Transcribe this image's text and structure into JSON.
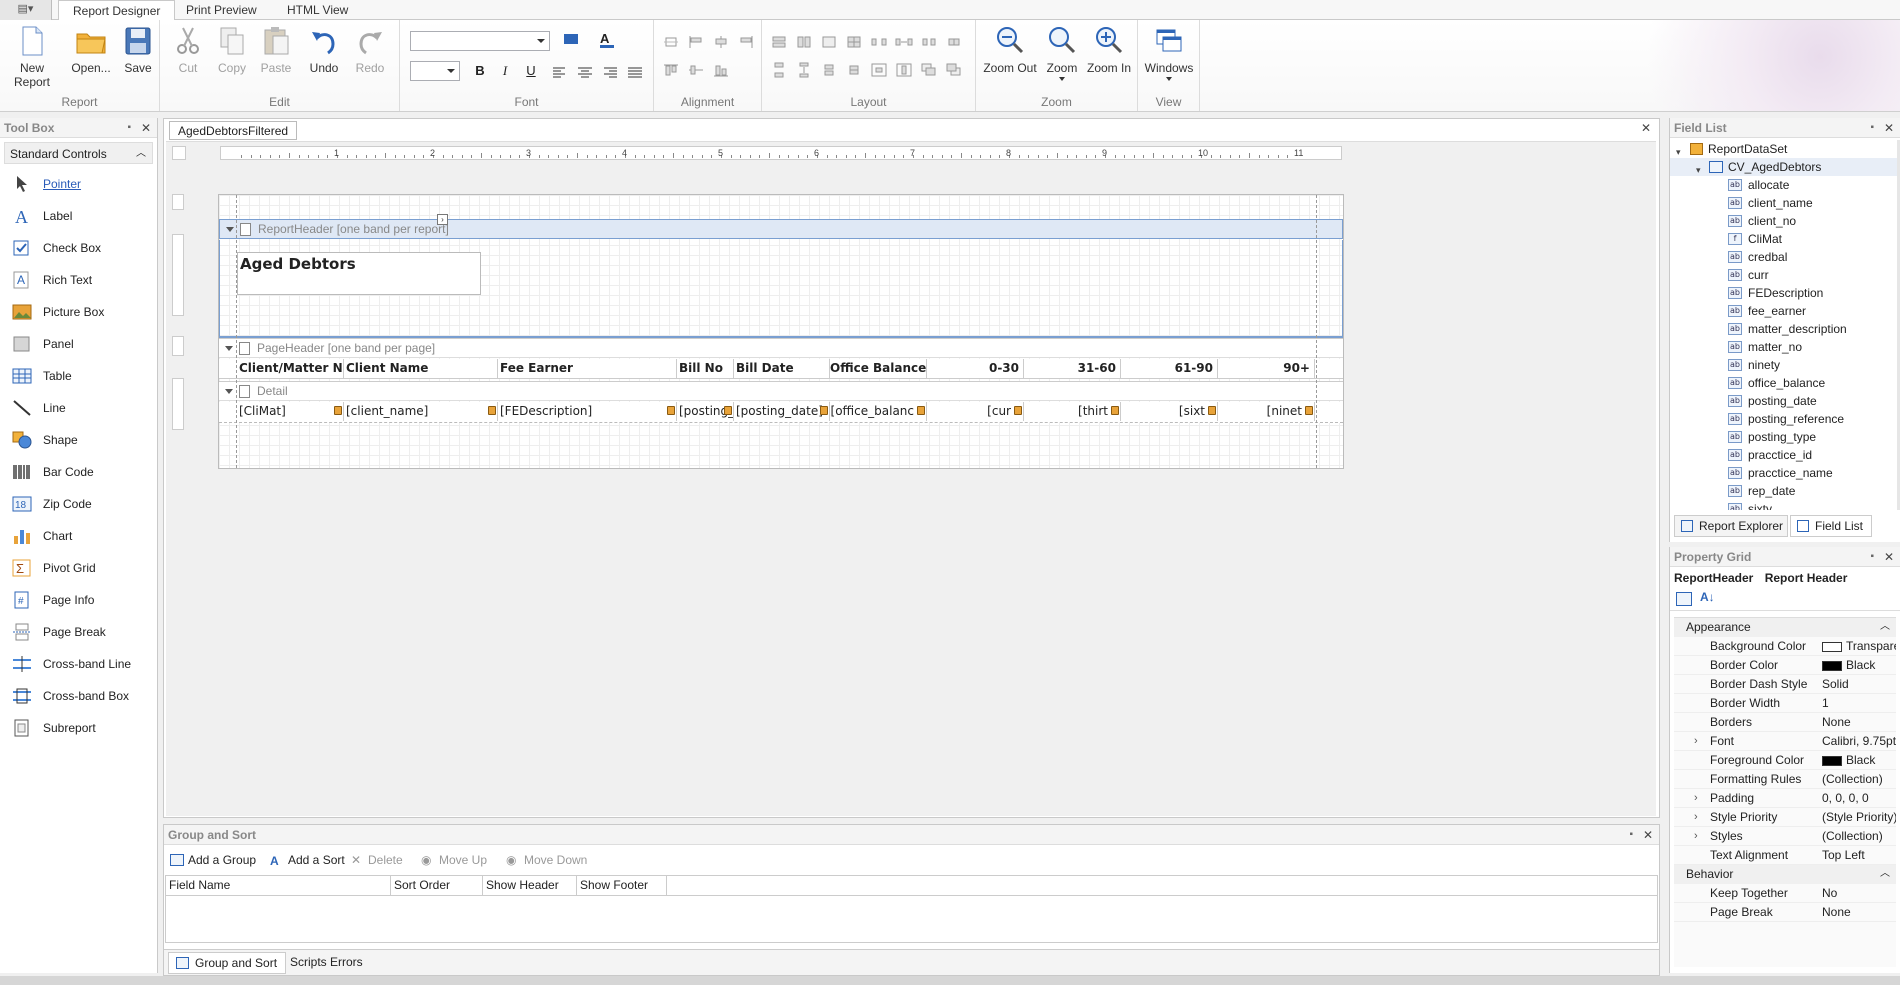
{
  "app": {
    "menu_button": "▤▾"
  },
  "tabs": [
    "Report Designer",
    "Print Preview",
    "HTML View"
  ],
  "ribbon": {
    "groups": {
      "report": "Report",
      "edit": "Edit",
      "font": "Font",
      "alignment": "Alignment",
      "layout": "Layout",
      "zoom": "Zoom",
      "view": "View"
    },
    "buttons": {
      "new_report": "New Report",
      "open": "Open...",
      "save": "Save",
      "cut": "Cut",
      "copy": "Copy",
      "paste": "Paste",
      "undo": "Undo",
      "redo": "Redo",
      "zoom_out": "Zoom Out",
      "zoom": "Zoom",
      "zoom_in": "Zoom In",
      "windows": "Windows"
    },
    "font_format": {
      "bold": "B",
      "italic": "I",
      "underline": "U"
    }
  },
  "toolbox": {
    "title": "Tool Box",
    "section": "Standard Controls",
    "items": [
      "Pointer",
      "Label",
      "Check Box",
      "Rich Text",
      "Picture Box",
      "Panel",
      "Table",
      "Line",
      "Shape",
      "Bar Code",
      "Zip Code",
      "Chart",
      "Pivot Grid",
      "Page Info",
      "Page Break",
      "Cross-band Line",
      "Cross-band Box",
      "Subreport"
    ]
  },
  "document": {
    "tab": "AgedDebtorsFiltered",
    "ruler_numbers": [
      "1",
      "2",
      "3",
      "4",
      "5",
      "6",
      "7",
      "8",
      "9",
      "10",
      "11"
    ],
    "bands": {
      "report_header": "ReportHeader [one band per report]",
      "page_header": "PageHeader [one band per page]",
      "detail": "Detail"
    },
    "report_title": "Aged Debtors",
    "header_cells": [
      "Client/Matter No",
      "Client Name",
      "Fee Earner",
      "Bill No",
      "Bill Date",
      "Office Balance",
      "0-30",
      "31-60",
      "61-90",
      "90+"
    ],
    "detail_cells": [
      "[CliMat]",
      "[client_name]",
      "[FEDescription]",
      "[posting_",
      "[posting_date]",
      "[office_balanc",
      "[cur",
      "[thirt",
      "[sixt",
      "[ninet"
    ]
  },
  "field_list": {
    "title": "Field List",
    "root": "ReportDataSet",
    "table": "CV_AgedDebtors",
    "fields": [
      {
        "name": "allocate",
        "icon": "ab"
      },
      {
        "name": "client_name",
        "icon": "ab"
      },
      {
        "name": "client_no",
        "icon": "ab"
      },
      {
        "name": "CliMat",
        "icon": "f"
      },
      {
        "name": "credbal",
        "icon": "ab"
      },
      {
        "name": "curr",
        "icon": "ab"
      },
      {
        "name": "FEDescription",
        "icon": "ab"
      },
      {
        "name": "fee_earner",
        "icon": "ab"
      },
      {
        "name": "matter_description",
        "icon": "ab"
      },
      {
        "name": "matter_no",
        "icon": "ab"
      },
      {
        "name": "ninety",
        "icon": "ab"
      },
      {
        "name": "office_balance",
        "icon": "ab"
      },
      {
        "name": "posting_date",
        "icon": "ab"
      },
      {
        "name": "posting_reference",
        "icon": "ab"
      },
      {
        "name": "posting_type",
        "icon": "ab"
      },
      {
        "name": "pracctice_id",
        "icon": "ab"
      },
      {
        "name": "pracctice_name",
        "icon": "ab"
      },
      {
        "name": "rep_date",
        "icon": "ab"
      },
      {
        "name": "sixty",
        "icon": "ab"
      }
    ],
    "tabs": [
      "Report Explorer",
      "Field List"
    ]
  },
  "property_grid": {
    "title": "Property Grid",
    "object_name": "ReportHeader",
    "object_type": "Report Header",
    "categories": [
      {
        "name": "Appearance",
        "rows": [
          {
            "name": "Background Color",
            "value": "Transparent",
            "swatch": "#ffffff"
          },
          {
            "name": "Border Color",
            "value": "Black",
            "swatch": "#000000"
          },
          {
            "name": "Border Dash Style",
            "value": "Solid"
          },
          {
            "name": "Border Width",
            "value": "1"
          },
          {
            "name": "Borders",
            "value": "None"
          },
          {
            "name": "Font",
            "value": "Calibri, 9.75pt",
            "expandable": true
          },
          {
            "name": "Foreground Color",
            "value": "Black",
            "swatch": "#000000"
          },
          {
            "name": "Formatting Rules",
            "value": "(Collection)"
          },
          {
            "name": "Padding",
            "value": "0, 0, 0, 0",
            "expandable": true
          },
          {
            "name": "Style Priority",
            "value": "(Style Priority)",
            "expandable": true
          },
          {
            "name": "Styles",
            "value": "(Collection)",
            "expandable": true
          },
          {
            "name": "Text Alignment",
            "value": "Top Left"
          }
        ]
      },
      {
        "name": "Behavior",
        "rows": [
          {
            "name": "Keep Together",
            "value": "No"
          },
          {
            "name": "Page Break",
            "value": "None"
          }
        ]
      }
    ]
  },
  "group_sort": {
    "title": "Group and Sort",
    "buttons": [
      "Add a Group",
      "Add a Sort",
      "Delete",
      "Move Up",
      "Move Down"
    ],
    "columns": [
      "Field Name",
      "Sort Order",
      "Show Header",
      "Show Footer"
    ],
    "tabs": [
      "Group and Sort",
      "Scripts Errors"
    ]
  }
}
